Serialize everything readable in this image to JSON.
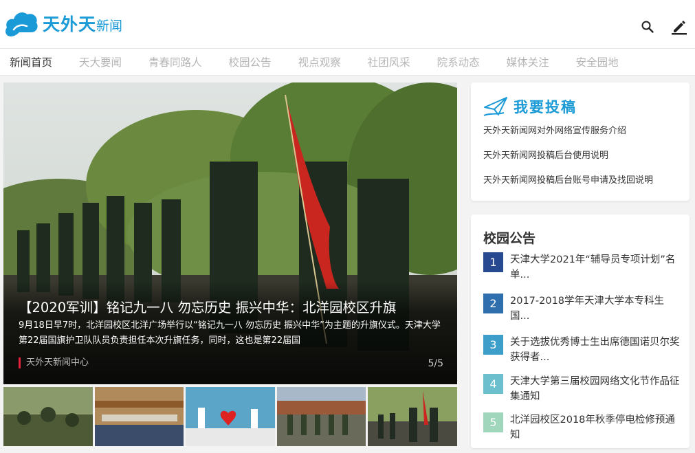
{
  "header": {
    "logo_main": "天外天",
    "logo_sub": "新闻",
    "icons": [
      "search-icon",
      "edit-icon"
    ]
  },
  "nav": {
    "items": [
      "新闻首页",
      "天大要闻",
      "青春同路人",
      "校园公告",
      "视点观察",
      "社团风采",
      "院系动态",
      "媒体关注",
      "安全园地"
    ],
    "active": "新闻首页"
  },
  "slider": {
    "title": "【2020军训】铭记九一八 勿忘历史 振兴中华：北洋园校区升旗",
    "desc": "9月18日早7时，北洋园校区北洋广场举行以“铭记九一八 勿忘历史 振兴中华”为主题的升旗仪式。天津大学第22届国旗护卫队队员负责担任本次升旗任务，同时，这也是第22届国",
    "source": "天外天新闻中心",
    "counter": "5/5"
  },
  "submit": {
    "title": "我要投稿",
    "links": [
      "天外天新闻网对外网络宣传服务介绍",
      "天外天新闻网投稿后台使用说明",
      "天外天新闻网投稿后台账号申请及找回说明"
    ]
  },
  "notices": {
    "title": "校园公告",
    "items": [
      {
        "num": "1",
        "text": "天津大学2021年“辅导员专项计划”名单..."
      },
      {
        "num": "2",
        "text": "2017-2018学年天津大学本专科生国..."
      },
      {
        "num": "3",
        "text": "关于选拔优秀博士生出席德国诺贝尔奖获得者..."
      },
      {
        "num": "4",
        "text": "天津大学第三届校园网络文化节作品征集通知"
      },
      {
        "num": "5",
        "text": "北洋园校区2018年秋季停电检修预通知"
      }
    ]
  },
  "colors": {
    "brand": "#1a9ad6",
    "accent_red": "#e0223a",
    "num_badges": [
      "#27498f",
      "#2f6fae",
      "#3d9fc9",
      "#6cbfcc",
      "#9fd6bc"
    ]
  }
}
